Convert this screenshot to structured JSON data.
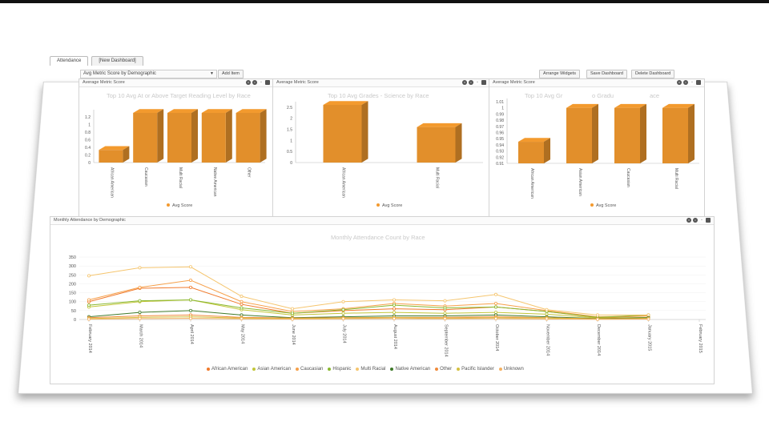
{
  "tabs": [
    {
      "label": "Attendance",
      "active": true
    },
    {
      "label": "[New Dashboard]",
      "active": false
    }
  ],
  "toolbar": {
    "select_value": "Avg Metric Score by Demographic",
    "add_item": "Add Item",
    "arrange_widgets": "Arrange Widgets",
    "save_dashboard": "Save Dashboard",
    "delete_dashboard": "Delete Dashboard"
  },
  "widgets": {
    "w1": {
      "header": "Average Metric Score"
    },
    "w2": {
      "header": "Average Metric Score"
    },
    "w3": {
      "header": "Average Metric Score"
    },
    "w4": {
      "header": "Monthly Attendance by Demographic"
    }
  },
  "chart_data": [
    {
      "type": "bar",
      "title": "Top 10 Avg At or Above Target Reading Level by Race",
      "categories": [
        "African American",
        "Caucasian",
        "Multi Racial",
        "Native American",
        "Other"
      ],
      "series": [
        {
          "name": "Avg Score",
          "values": [
            0.33,
            1.3,
            1.3,
            1.3,
            1.3
          ]
        }
      ],
      "ylim": [
        0,
        1.3
      ],
      "yticks": [
        "0",
        "0.2",
        "0.4",
        "0.6",
        "0.8",
        "1",
        "1.2"
      ],
      "color": "#f39a2e"
    },
    {
      "type": "bar",
      "title": "Top 10 Avg Grades - Science by Race",
      "categories": [
        "African American",
        "Multi Racial"
      ],
      "series": [
        {
          "name": "Avg Score",
          "values": [
            2.6,
            1.6
          ]
        }
      ],
      "ylim": [
        0,
        2.6
      ],
      "yticks": [
        "0",
        "0.5",
        "1",
        "1.5",
        "2",
        "2.5"
      ],
      "color": "#f39a2e"
    },
    {
      "type": "bar",
      "title": "Top 10 Avg Gr",
      "title_tail": "o Gradu",
      "title_end": "ace",
      "categories": [
        "African American",
        "Asian American",
        "Caucasian",
        "Multi Racial"
      ],
      "series": [
        {
          "name": "Avg Score",
          "values": [
            0.945,
            1.0,
            1.0,
            1.0
          ]
        }
      ],
      "ylim": [
        0.91,
        1.01
      ],
      "yticks": [
        "0.91",
        "0.92",
        "0.93",
        "0.94",
        "0.95",
        "0.96",
        "0.97",
        "0.98",
        "0.99",
        "1",
        "1.01"
      ],
      "color": "#f39a2e"
    },
    {
      "type": "line",
      "title": "Monthly Attendance Count by Race",
      "x": [
        "February 2014",
        "March 2014",
        "April 2014",
        "May 2014",
        "June 2014",
        "July 2014",
        "August 2014",
        "September 2014",
        "October 2014",
        "November 2014",
        "December 2014",
        "January 2015",
        "February 2015"
      ],
      "ylim": [
        0,
        350
      ],
      "yticks": [
        "0",
        "50",
        "100",
        "150",
        "200",
        "250",
        "300",
        "350"
      ],
      "series": [
        {
          "name": "African American",
          "color": "#f07a2c",
          "values": [
            100,
            175,
            180,
            85,
            35,
            50,
            60,
            55,
            70,
            45,
            10,
            20,
            null
          ]
        },
        {
          "name": "Asian American",
          "color": "#c2c63a",
          "values": [
            70,
            100,
            110,
            55,
            25,
            35,
            40,
            35,
            40,
            30,
            8,
            12,
            null
          ]
        },
        {
          "name": "Caucasian",
          "color": "#f6a04a",
          "values": [
            110,
            180,
            220,
            100,
            45,
            60,
            90,
            75,
            90,
            50,
            15,
            20,
            null
          ]
        },
        {
          "name": "Hispanic",
          "color": "#8ab830",
          "values": [
            80,
            105,
            110,
            65,
            35,
            55,
            80,
            65,
            70,
            45,
            12,
            25,
            null
          ]
        },
        {
          "name": "Multi Racial",
          "color": "#f5c56e",
          "values": [
            245,
            290,
            295,
            130,
            60,
            100,
            110,
            105,
            140,
            55,
            25,
            25,
            null
          ]
        },
        {
          "name": "Native American",
          "color": "#3f7a2a",
          "values": [
            15,
            40,
            50,
            25,
            10,
            15,
            20,
            20,
            25,
            15,
            5,
            10,
            null
          ]
        },
        {
          "name": "Other",
          "color": "#f08a3a",
          "values": [
            10,
            20,
            25,
            12,
            8,
            10,
            12,
            12,
            15,
            10,
            4,
            6,
            null
          ]
        },
        {
          "name": "Pacific Islander",
          "color": "#d4c040",
          "values": [
            5,
            12,
            15,
            8,
            5,
            8,
            10,
            8,
            10,
            8,
            3,
            5,
            null
          ]
        },
        {
          "name": "Unknown",
          "color": "#f4b060",
          "values": [
            2,
            5,
            6,
            4,
            2,
            4,
            5,
            4,
            5,
            3,
            1,
            2,
            null
          ]
        }
      ]
    }
  ]
}
